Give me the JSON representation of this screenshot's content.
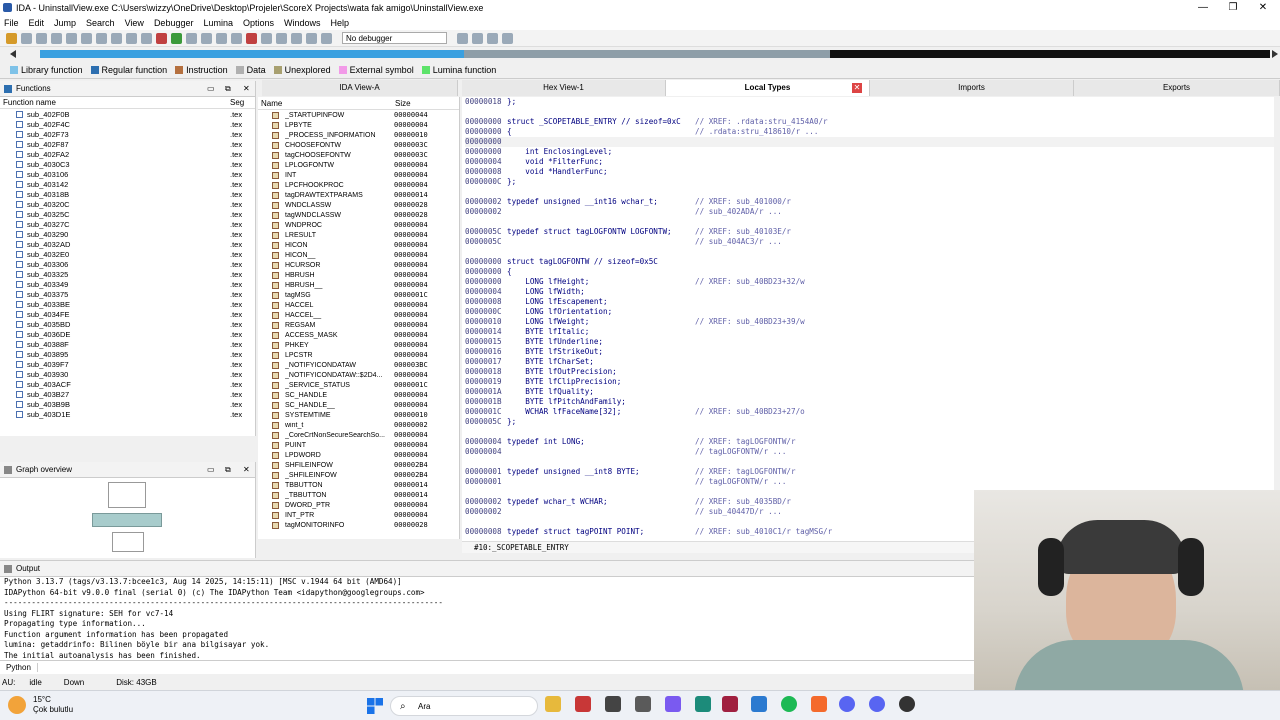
{
  "window": {
    "title": "IDA - UninstallView.exe C:\\Users\\wizzy\\OneDrive\\Desktop\\Projeler\\ScoreX Projects\\wata fak amigo\\UninstallView.exe",
    "minimize": "—",
    "restore": "❐",
    "close": "✕"
  },
  "menu": [
    "File",
    "Edit",
    "Jump",
    "Search",
    "View",
    "Debugger",
    "Lumina",
    "Options",
    "Windows",
    "Help"
  ],
  "toolbar": {
    "debugger_select": "No debugger"
  },
  "legend": [
    {
      "label": "Library function",
      "color": "#7ec2e8"
    },
    {
      "label": "Regular function",
      "color": "#2d6fb0"
    },
    {
      "label": "Instruction",
      "color": "#b5703f"
    },
    {
      "label": "Data",
      "color": "#b0b0b0"
    },
    {
      "label": "Unexplored",
      "color": "#a8a070"
    },
    {
      "label": "External symbol",
      "color": "#f29ae8"
    },
    {
      "label": "Lumina function",
      "color": "#5de36a"
    }
  ],
  "functions": {
    "title": "Functions",
    "col_name": "Function name",
    "col_seg": "Seg",
    "rows": [
      [
        "sub_402F0B",
        ".tex"
      ],
      [
        "sub_402F4C",
        ".tex"
      ],
      [
        "sub_402F73",
        ".tex"
      ],
      [
        "sub_402F87",
        ".tex"
      ],
      [
        "sub_402FA2",
        ".tex"
      ],
      [
        "sub_4030C3",
        ".tex"
      ],
      [
        "sub_403106",
        ".tex"
      ],
      [
        "sub_403142",
        ".tex"
      ],
      [
        "sub_40318B",
        ".tex"
      ],
      [
        "sub_40320C",
        ".tex"
      ],
      [
        "sub_40325C",
        ".tex"
      ],
      [
        "sub_40327C",
        ".tex"
      ],
      [
        "sub_403290",
        ".tex"
      ],
      [
        "sub_4032AD",
        ".tex"
      ],
      [
        "sub_4032E0",
        ".tex"
      ],
      [
        "sub_403306",
        ".tex"
      ],
      [
        "sub_403325",
        ".tex"
      ],
      [
        "sub_403349",
        ".tex"
      ],
      [
        "sub_403375",
        ".tex"
      ],
      [
        "sub_4033BE",
        ".tex"
      ],
      [
        "sub_4034FE",
        ".tex"
      ],
      [
        "sub_4035BD",
        ".tex"
      ],
      [
        "sub_4036DE",
        ".tex"
      ],
      [
        "sub_40388F",
        ".tex"
      ],
      [
        "sub_403895",
        ".tex"
      ],
      [
        "sub_4039F7",
        ".tex"
      ],
      [
        "sub_403930",
        ".tex"
      ],
      [
        "sub_403ACF",
        ".tex"
      ],
      [
        "sub_403B27",
        ".tex"
      ],
      [
        "sub_403B9B",
        ".tex"
      ],
      [
        "sub_403D1E",
        ".tex"
      ]
    ]
  },
  "graph_overview": {
    "title": "Graph overview"
  },
  "tabs": {
    "ida_view": "IDA View-A",
    "hex_view": "Hex View-1",
    "local_types": "Local Types",
    "imports": "Imports",
    "exports": "Exports"
  },
  "local_types": {
    "col_name": "Name",
    "col_size": "Size",
    "rows": [
      [
        "_STARTUPINFOW",
        "00000044"
      ],
      [
        "LPBYTE",
        "00000004"
      ],
      [
        "_PROCESS_INFORMATION",
        "00000010"
      ],
      [
        "CHOOSEFONTW",
        "0000003C"
      ],
      [
        "tagCHOOSEFONTW",
        "0000003C"
      ],
      [
        "LPLOGFONTW",
        "00000004"
      ],
      [
        "INT",
        "00000004"
      ],
      [
        "LPCFHOOKPROC",
        "00000004"
      ],
      [
        "tagDRAWTEXTPARAMS",
        "00000014"
      ],
      [
        "WNDCLASSW",
        "00000028"
      ],
      [
        "tagWNDCLASSW",
        "00000028"
      ],
      [
        "WNDPROC",
        "00000004"
      ],
      [
        "LRESULT",
        "00000004"
      ],
      [
        "HICON",
        "00000004"
      ],
      [
        "HICON__",
        "00000004"
      ],
      [
        "HCURSOR",
        "00000004"
      ],
      [
        "HBRUSH",
        "00000004"
      ],
      [
        "HBRUSH__",
        "00000004"
      ],
      [
        "tagMSG",
        "0000001C"
      ],
      [
        "HACCEL",
        "00000004"
      ],
      [
        "HACCEL__",
        "00000004"
      ],
      [
        "REGSAM",
        "00000004"
      ],
      [
        "ACCESS_MASK",
        "00000004"
      ],
      [
        "PHKEY",
        "00000004"
      ],
      [
        "LPCSTR",
        "00000004"
      ],
      [
        "_NOTIFYICONDATAW",
        "000003BC"
      ],
      [
        "_NOTIFYICONDATAW::$2D4...",
        "00000004"
      ],
      [
        "_SERVICE_STATUS",
        "0000001C"
      ],
      [
        "SC_HANDLE",
        "00000004"
      ],
      [
        "SC_HANDLE__",
        "00000004"
      ],
      [
        "SYSTEMTIME",
        "00000010"
      ],
      [
        "wint_t",
        "00000002"
      ],
      [
        "_CoreCrtNonSecureSearchSo...",
        "00000004"
      ],
      [
        "PUINT",
        "00000004"
      ],
      [
        "LPDWORD",
        "00000004"
      ],
      [
        "SHFILEINFOW",
        "000002B4"
      ],
      [
        "_SHFILEINFOW",
        "000002B4"
      ],
      [
        "TBBUTTON",
        "00000014"
      ],
      [
        "_TBBUTTON",
        "00000014"
      ],
      [
        "DWORD_PTR",
        "00000004"
      ],
      [
        "INT_PTR",
        "00000004"
      ],
      [
        "tagMONITORINFO",
        "00000028"
      ]
    ]
  },
  "code_lines": [
    {
      "a": "00000018",
      "t": "};",
      "c": ""
    },
    {
      "a": "",
      "t": "",
      "c": ""
    },
    {
      "a": "00000000",
      "t": "struct _SCOPETABLE_ENTRY // sizeof=0xC",
      "c": "// XREF: .rdata:stru_4154A0/r"
    },
    {
      "a": "00000000",
      "t": "{",
      "c": "// .rdata:stru_418610/r ..."
    },
    {
      "a": "00000000",
      "t": "",
      "c": ""
    },
    {
      "a": "00000000",
      "t": "    int EnclosingLevel;",
      "c": ""
    },
    {
      "a": "00000004",
      "t": "    void *FilterFunc;",
      "c": ""
    },
    {
      "a": "00000008",
      "t": "    void *HandlerFunc;",
      "c": ""
    },
    {
      "a": "0000000C",
      "t": "};",
      "c": ""
    },
    {
      "a": "",
      "t": "",
      "c": ""
    },
    {
      "a": "00000002",
      "t": "typedef unsigned __int16 wchar_t;",
      "c": "// XREF: sub_401000/r"
    },
    {
      "a": "00000002",
      "t": "",
      "c": "// sub_402ADA/r ..."
    },
    {
      "a": "",
      "t": "",
      "c": ""
    },
    {
      "a": "0000005C",
      "t": "typedef struct tagLOGFONTW LOGFONTW;",
      "c": "// XREF: sub_40103E/r"
    },
    {
      "a": "0000005C",
      "t": "",
      "c": "// sub_404AC3/r ..."
    },
    {
      "a": "",
      "t": "",
      "c": ""
    },
    {
      "a": "00000000",
      "t": "struct tagLOGFONTW // sizeof=0x5C",
      "c": ""
    },
    {
      "a": "00000000",
      "t": "{",
      "c": ""
    },
    {
      "a": "00000000",
      "t": "    LONG lfHeight;",
      "c": "// XREF: sub_40BD23+32/w"
    },
    {
      "a": "00000004",
      "t": "    LONG lfWidth;",
      "c": ""
    },
    {
      "a": "00000008",
      "t": "    LONG lfEscapement;",
      "c": ""
    },
    {
      "a": "0000000C",
      "t": "    LONG lfOrientation;",
      "c": ""
    },
    {
      "a": "00000010",
      "t": "    LONG lfWeight;",
      "c": "// XREF: sub_40BD23+39/w"
    },
    {
      "a": "00000014",
      "t": "    BYTE lfItalic;",
      "c": ""
    },
    {
      "a": "00000015",
      "t": "    BYTE lfUnderline;",
      "c": ""
    },
    {
      "a": "00000016",
      "t": "    BYTE lfStrikeOut;",
      "c": ""
    },
    {
      "a": "00000017",
      "t": "    BYTE lfCharSet;",
      "c": ""
    },
    {
      "a": "00000018",
      "t": "    BYTE lfOutPrecision;",
      "c": ""
    },
    {
      "a": "00000019",
      "t": "    BYTE lfClipPrecision;",
      "c": ""
    },
    {
      "a": "0000001A",
      "t": "    BYTE lfQuality;",
      "c": ""
    },
    {
      "a": "0000001B",
      "t": "    BYTE lfPitchAndFamily;",
      "c": ""
    },
    {
      "a": "0000001C",
      "t": "    WCHAR lfFaceName[32];",
      "c": "// XREF: sub_40BD23+27/o"
    },
    {
      "a": "0000005C",
      "t": "};",
      "c": ""
    },
    {
      "a": "",
      "t": "",
      "c": ""
    },
    {
      "a": "00000004",
      "t": "typedef int LONG;",
      "c": "// XREF: tagLOGFONTW/r"
    },
    {
      "a": "00000004",
      "t": "",
      "c": "// tagLOGFONTW/r ..."
    },
    {
      "a": "",
      "t": "",
      "c": ""
    },
    {
      "a": "00000001",
      "t": "typedef unsigned __int8 BYTE;",
      "c": "// XREF: tagLOGFONTW/r"
    },
    {
      "a": "00000001",
      "t": "",
      "c": "// tagLOGFONTW/r ..."
    },
    {
      "a": "",
      "t": "",
      "c": ""
    },
    {
      "a": "00000002",
      "t": "typedef wchar_t WCHAR;",
      "c": "// XREF: sub_4035BD/r"
    },
    {
      "a": "00000002",
      "t": "",
      "c": "// sub_40447D/r ..."
    },
    {
      "a": "",
      "t": "",
      "c": ""
    },
    {
      "a": "00000008",
      "t": "typedef struct tagPOINT POINT;",
      "c": "// XREF: sub_4010C1/r tagMSG/r"
    }
  ],
  "local_types_status": "#10:_SCOPETABLE_ENTRY",
  "output": {
    "title": "Output",
    "lines": [
      "Python 3.13.7 (tags/v3.13.7:bcee1c3, Aug 14 2025, 14:15:11) [MSC v.1944 64 bit (AMD64)]",
      "IDAPython 64-bit v9.0.0 final (serial 0) (c) The IDAPython Team <idapython@googlegroups.com>",
      "------------------------------------------------------------------------------------------------",
      "Using FLIRT signature: SEH for vc7-14",
      "Propagating type information...",
      "Function argument information has been propagated",
      "lumina: getaddrinfo: Bilinen böyle bir ana bilgisayar yok.",
      "The initial autoanalysis has been finished."
    ],
    "input_label": "Python"
  },
  "statusbar": {
    "au": "AU:",
    "state": "idle",
    "dir": "Down",
    "disk": "Disk: 43GB"
  },
  "taskbar": {
    "weather_temp": "15°C",
    "weather_desc": "Çok bulutlu",
    "search": "Ara"
  }
}
